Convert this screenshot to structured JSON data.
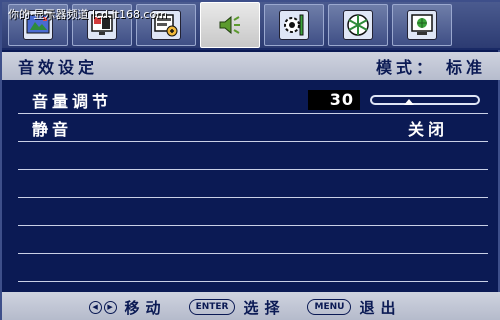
{
  "watermark": "你的·显示器频道 lcd.it168.com",
  "tabs": [
    {
      "icon": "picture-icon"
    },
    {
      "icon": "display-icon"
    },
    {
      "icon": "picture-advanced-icon"
    },
    {
      "icon": "speaker-icon",
      "active": true
    },
    {
      "icon": "settings-icon"
    },
    {
      "icon": "eco-icon"
    },
    {
      "icon": "system-icon"
    }
  ],
  "header": {
    "title": "音效设定",
    "mode_label": "模式：",
    "mode_value": "标准"
  },
  "rows": [
    {
      "label": "音量调节",
      "value": "30",
      "slider_fraction": 0.3
    },
    {
      "label": "静音",
      "value": "关闭"
    }
  ],
  "footer": {
    "move_label": "移动",
    "enter_key": "ENTER",
    "select_label": "选择",
    "menu_key": "MENU",
    "exit_label": "退出"
  },
  "colors": {
    "background": "#0b1a54",
    "bar": "#cfd3df",
    "active_tab": "#e9e9e9"
  }
}
